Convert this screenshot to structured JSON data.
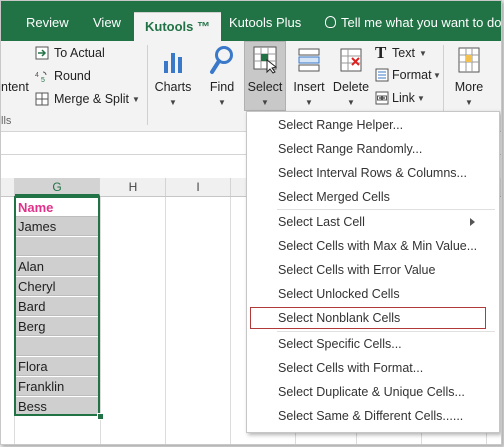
{
  "tabs": [
    {
      "label": "Review",
      "active": false
    },
    {
      "label": "View",
      "active": false
    },
    {
      "label": "Kutools ™",
      "active": true
    },
    {
      "label": "Kutools Plus",
      "active": false
    }
  ],
  "tell_me": "Tell me what you want to do",
  "ribbon": {
    "left_partial": "ntent",
    "group_partial": "lls",
    "to_actual": "To Actual",
    "round": "Round",
    "merge_split": "Merge & Split",
    "charts": "Charts",
    "find": "Find",
    "select": "Select",
    "insert": "Insert",
    "delete": "Delete",
    "text": "Text",
    "format": "Format",
    "link": "Link",
    "more": "More"
  },
  "columns": [
    "G",
    "H",
    "I"
  ],
  "cells": [
    "Name",
    "James",
    "",
    "Alan",
    "Cheryl",
    "Bard",
    "Berg",
    "",
    "Flora",
    "Franklin",
    "Bess"
  ],
  "menu": {
    "items": [
      {
        "label": "Select Range Helper..."
      },
      {
        "label": "Select Range Randomly..."
      },
      {
        "label": "Select Interval Rows & Columns..."
      },
      {
        "label": "Select Merged Cells"
      },
      {
        "label": "Select Last Cell"
      },
      {
        "label": "Select Cells with Max & Min Value..."
      },
      {
        "label": "Select Cells with Error Value"
      },
      {
        "label": "Select Unlocked Cells"
      },
      {
        "label": "Select Nonblank Cells"
      },
      {
        "label": "Select Specific Cells..."
      },
      {
        "label": "Select Cells with Format..."
      },
      {
        "label": "Select Duplicate & Unique Cells..."
      },
      {
        "label": "Select Same & Different Cells......"
      }
    ]
  },
  "colors": {
    "excel_green": "#217346",
    "name_header": "#e0308a",
    "highlight_border": "#b03a3a"
  }
}
